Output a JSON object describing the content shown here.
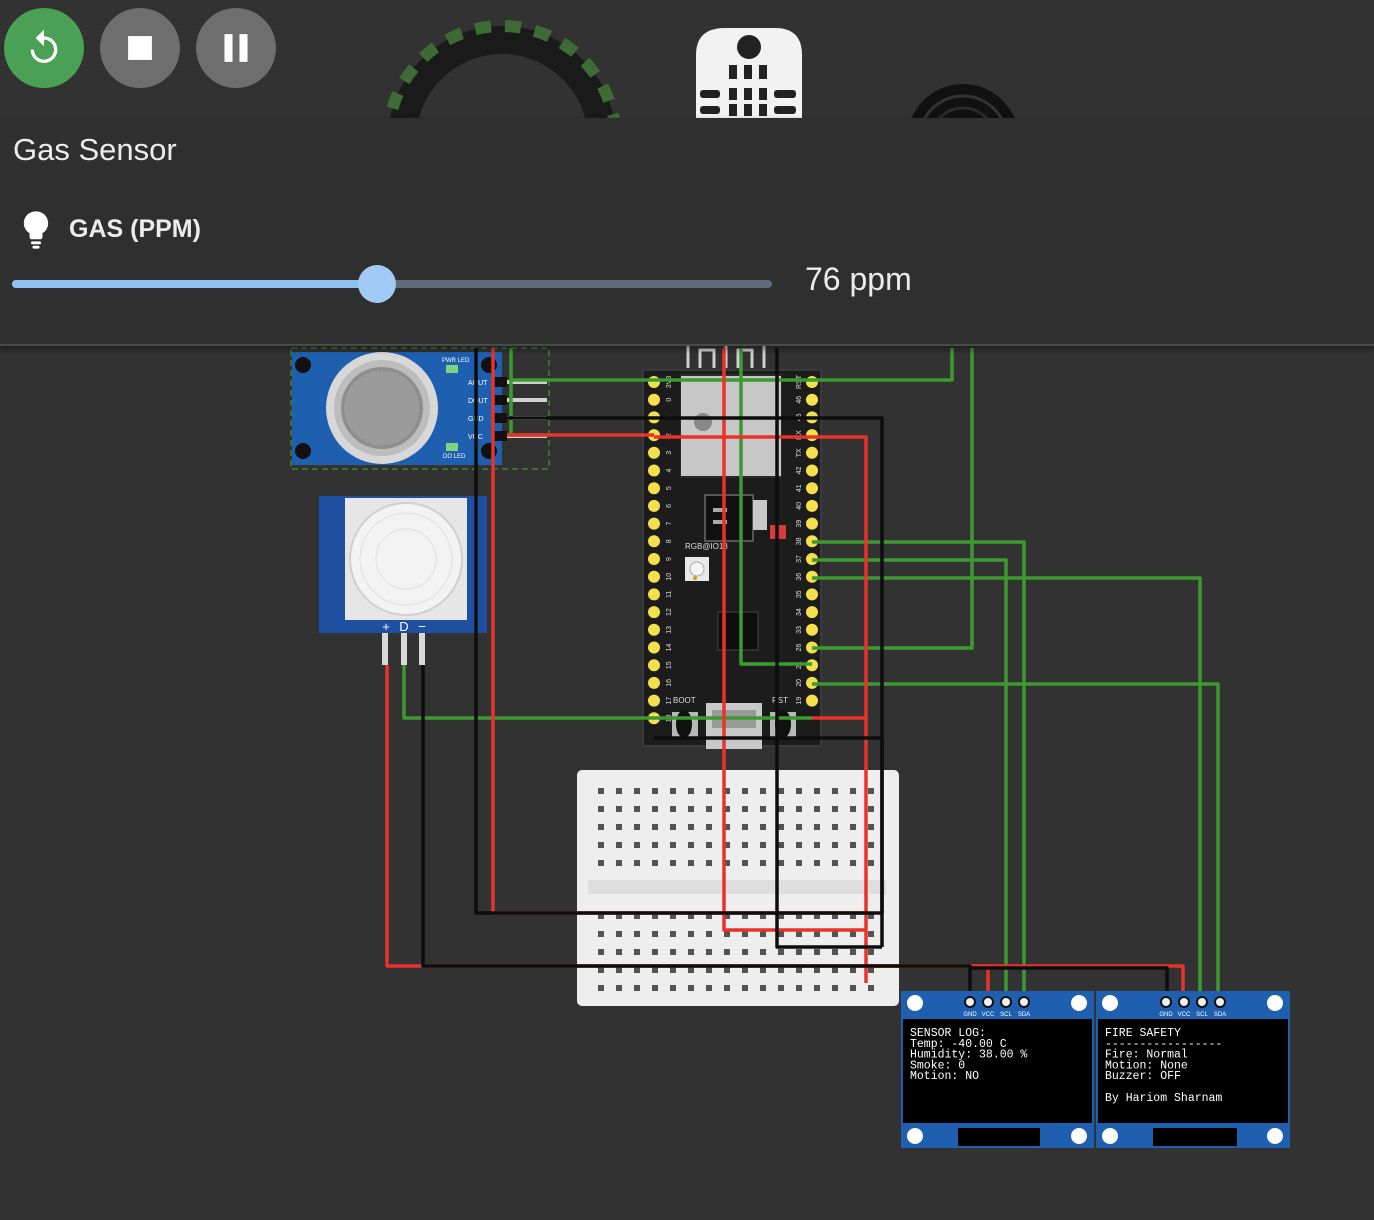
{
  "controls": {
    "restart_icon": "restart-icon",
    "stop_icon": "stop-icon",
    "pause_icon": "pause-icon",
    "restart_color": "#4aa055",
    "button_color": "#6e6e6e"
  },
  "panel": {
    "title": "Gas Sensor",
    "gas_label": "GAS (PPM)",
    "gas_icon": "lightbulb-icon",
    "gas_value": "76 ppm",
    "slider_fraction": 0.48
  },
  "esp32": {
    "left_pins": [
      "3V3",
      "0",
      "1",
      "2",
      "3",
      "4",
      "5",
      "6",
      "7",
      "8",
      "9",
      "10",
      "11",
      "12",
      "13",
      "14",
      "15",
      "16",
      "17",
      "18"
    ],
    "right_pins": [
      "RST",
      "46",
      "45",
      "RX",
      "TX",
      "42",
      "41",
      "40",
      "39",
      "38",
      "37",
      "36",
      "35",
      "34",
      "33",
      "26",
      "21",
      "20",
      "19"
    ],
    "rgb_label": "RGB@IO18",
    "boot_label": "BOOT",
    "rst_label": "RST"
  },
  "mq2": {
    "pins": [
      "AOUT",
      "DOUT",
      "GND",
      "VCC"
    ],
    "pwr_led": "PWR LED",
    "do_led": "DO LED"
  },
  "pir": {
    "pins": [
      "+",
      "D",
      "−"
    ]
  },
  "oled_left": {
    "pins": [
      "GND",
      "VCC",
      "SCL",
      "SDA"
    ],
    "lines": [
      "SENSOR LOG:",
      "Temp: -40.00 C",
      "Humidity: 38.00 %",
      "Smoke: 0",
      "Motion: NO"
    ]
  },
  "oled_right": {
    "pins": [
      "GND",
      "VCC",
      "SCL",
      "SDA"
    ],
    "lines": [
      "FIRE SAFETY",
      "-----------------",
      "Fire: Normal",
      "Motion: None",
      "Buzzer: OFF",
      "",
      "By Hariom Sharnam"
    ]
  },
  "colors": {
    "wire_green": "#3c9a30",
    "wire_red": "#e8322a",
    "wire_black": "#0d0d0d",
    "background": "#323232",
    "panel": "#2f2f2f",
    "slider_fill": "#90c2f0",
    "board_blue": "#1e5fb0"
  }
}
